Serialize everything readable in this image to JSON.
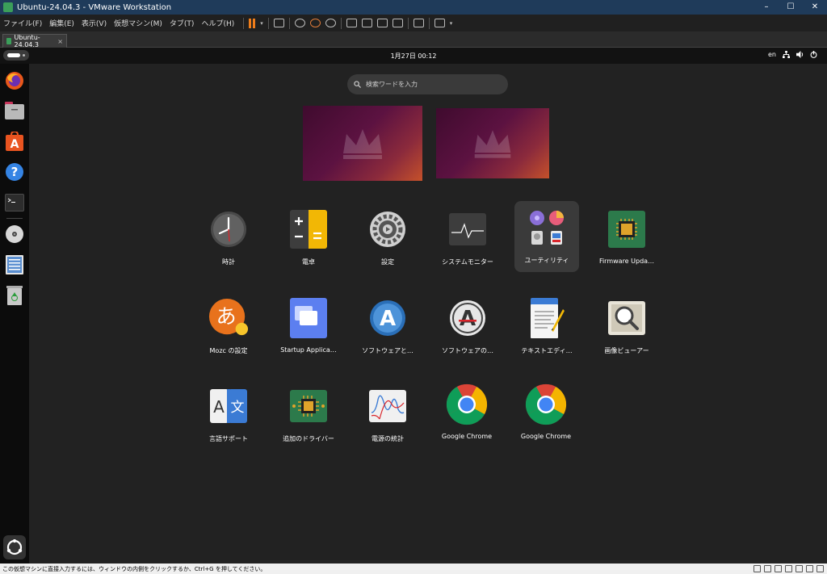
{
  "window": {
    "title": "Ubuntu-24.04.3 - VMware Workstation",
    "controls": [
      "–",
      "☐",
      "✕"
    ]
  },
  "menubar": {
    "items": [
      "ファイル(F)",
      "編集(E)",
      "表示(V)",
      "仮想マシン(M)",
      "タブ(T)",
      "ヘルプ(H)"
    ]
  },
  "tab": {
    "label": "Ubuntu-24.04.3",
    "close": "×"
  },
  "topbar": {
    "clock": "1月27日  00:12",
    "lang": "en"
  },
  "search": {
    "placeholder": "検索ワードを入力"
  },
  "apps": [
    {
      "label": "時計",
      "icon": "clock-icon"
    },
    {
      "label": "電卓",
      "icon": "calculator-icon"
    },
    {
      "label": "設定",
      "icon": "settings-gear-icon"
    },
    {
      "label": "システムモニター",
      "icon": "system-monitor-icon"
    },
    {
      "label": "ユーティリティ",
      "icon": "utilities-folder-icon"
    },
    {
      "label": "Firmware Upda…",
      "icon": "firmware-chip-icon"
    },
    {
      "label": "Mozc の設定",
      "icon": "mozc-icon"
    },
    {
      "label": "Startup Applica…",
      "icon": "startup-apps-icon"
    },
    {
      "label": "ソフトウェアと…",
      "icon": "software-updates-icon"
    },
    {
      "label": "ソフトウェアの…",
      "icon": "software-updater-icon"
    },
    {
      "label": "テキストエディ…",
      "icon": "text-editor-icon"
    },
    {
      "label": "画像ビューアー",
      "icon": "image-viewer-icon"
    },
    {
      "label": "言語サポート",
      "icon": "language-support-icon"
    },
    {
      "label": "追加のドライバー",
      "icon": "drivers-chip-icon"
    },
    {
      "label": "電源の統計",
      "icon": "power-statistics-icon"
    },
    {
      "label": "Google Chrome",
      "icon": "chrome-icon"
    },
    {
      "label": "Google Chrome",
      "icon": "chrome-icon"
    }
  ],
  "status": {
    "text": "この仮想マシンに直接入力するには、ウィンドウの内側をクリックするか、Ctrl+G を押してください。"
  },
  "colors": {
    "accent": "#e95420",
    "panel": "#222222",
    "dock": "#0c0c0c",
    "selected": "#3a3a3a"
  }
}
